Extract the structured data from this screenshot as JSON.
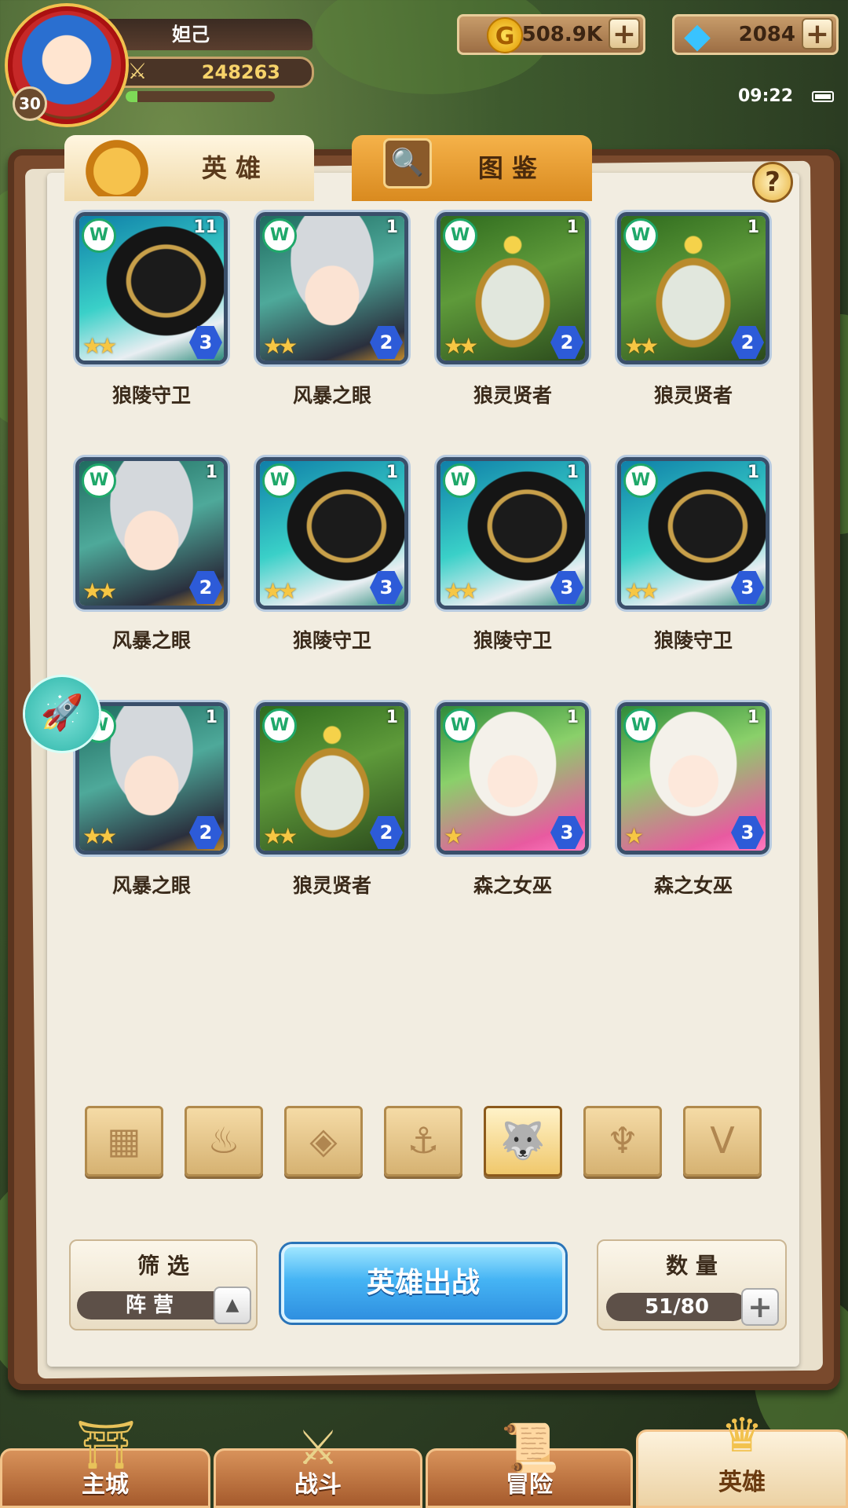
{
  "player": {
    "name": "妲己",
    "level": "30",
    "power": "248263",
    "exp_fraction": 0.08
  },
  "currency": {
    "gold": "508.9K",
    "gems": "2084"
  },
  "status": {
    "time": "09:22"
  },
  "tabs": {
    "heroes": "英 雄",
    "codex": "图 鉴"
  },
  "heroes": [
    {
      "name": "狼陵守卫",
      "count": "11",
      "stars": 2,
      "level": "3",
      "type": "wolf"
    },
    {
      "name": "风暴之眼",
      "count": "1",
      "stars": 2,
      "level": "2",
      "type": "storm"
    },
    {
      "name": "狼灵贤者",
      "count": "1",
      "stars": 2,
      "level": "2",
      "type": "sage"
    },
    {
      "name": "狼灵贤者",
      "count": "1",
      "stars": 2,
      "level": "2",
      "type": "sage"
    },
    {
      "name": "风暴之眼",
      "count": "1",
      "stars": 2,
      "level": "2",
      "type": "storm"
    },
    {
      "name": "狼陵守卫",
      "count": "1",
      "stars": 2,
      "level": "3",
      "type": "wolf"
    },
    {
      "name": "狼陵守卫",
      "count": "1",
      "stars": 2,
      "level": "3",
      "type": "wolf"
    },
    {
      "name": "狼陵守卫",
      "count": "1",
      "stars": 2,
      "level": "3",
      "type": "wolf"
    },
    {
      "name": "风暴之眼",
      "count": "1",
      "stars": 2,
      "level": "2",
      "type": "storm"
    },
    {
      "name": "狼灵贤者",
      "count": "1",
      "stars": 2,
      "level": "2",
      "type": "sage"
    },
    {
      "name": "森之女巫",
      "count": "1",
      "stars": 1,
      "level": "3",
      "type": "witch"
    },
    {
      "name": "森之女巫",
      "count": "1",
      "stars": 1,
      "level": "3",
      "type": "witch"
    }
  ],
  "filter_icons": [
    "grid-icon",
    "flame-icon",
    "diamond-icon",
    "anchor-icon",
    "wolf-head-icon",
    "horns-icon",
    "v-wing-icon"
  ],
  "filter_active_index": 4,
  "sort": {
    "label": "筛 选",
    "value": "阵 营"
  },
  "deploy_label": "英雄出战",
  "capacity": {
    "label": "数 量",
    "value": "51/80"
  },
  "nav": {
    "city": "主城",
    "battle": "战斗",
    "adventure": "冒险",
    "heroes": "英雄"
  },
  "colors": {
    "accent_blue": "#45b4f4",
    "star": "#f6c744",
    "faction_green": "#1fa86a"
  }
}
